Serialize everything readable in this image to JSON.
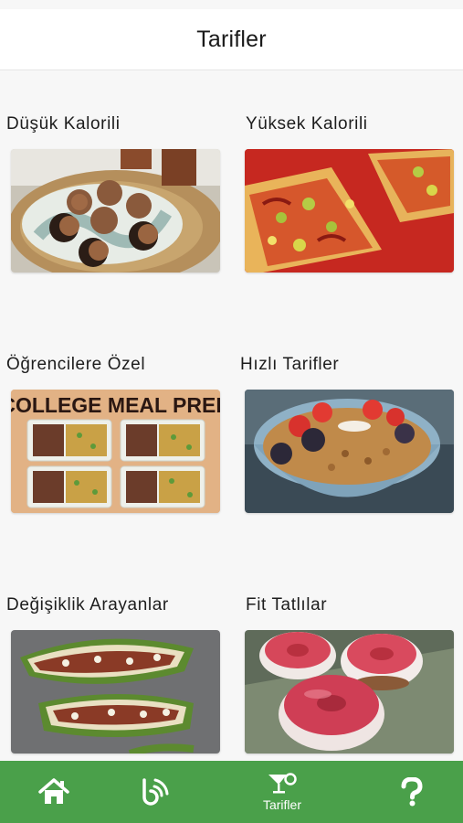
{
  "header": {
    "title": "Tarifler"
  },
  "categories": [
    {
      "label": "Düşük Kalorili",
      "image": "cookies-plate-photo"
    },
    {
      "label": "Yüksek Kalorili",
      "image": "pepper-pizza-photo"
    },
    {
      "label": "Öğrencilere Özel",
      "image": "meal-prep-photo",
      "image_text": "COLLEGE MEAL PREP"
    },
    {
      "label": "Hızlı Tarifler",
      "image": "granola-bowl-photo"
    },
    {
      "label": "Değişiklik Arayanlar",
      "image": "stuffed-zucchini-photo"
    },
    {
      "label": "Fit Tatlılar",
      "image": "jelly-donuts-photo"
    }
  ],
  "tabbar": {
    "background": "#4aa04a",
    "active_label": "Tarifler",
    "items": [
      {
        "icon": "home-icon"
      },
      {
        "icon": "feed-icon"
      },
      {
        "icon": "cocktail-icon",
        "label": "Tarifler"
      },
      {
        "icon": "question-icon"
      }
    ]
  }
}
